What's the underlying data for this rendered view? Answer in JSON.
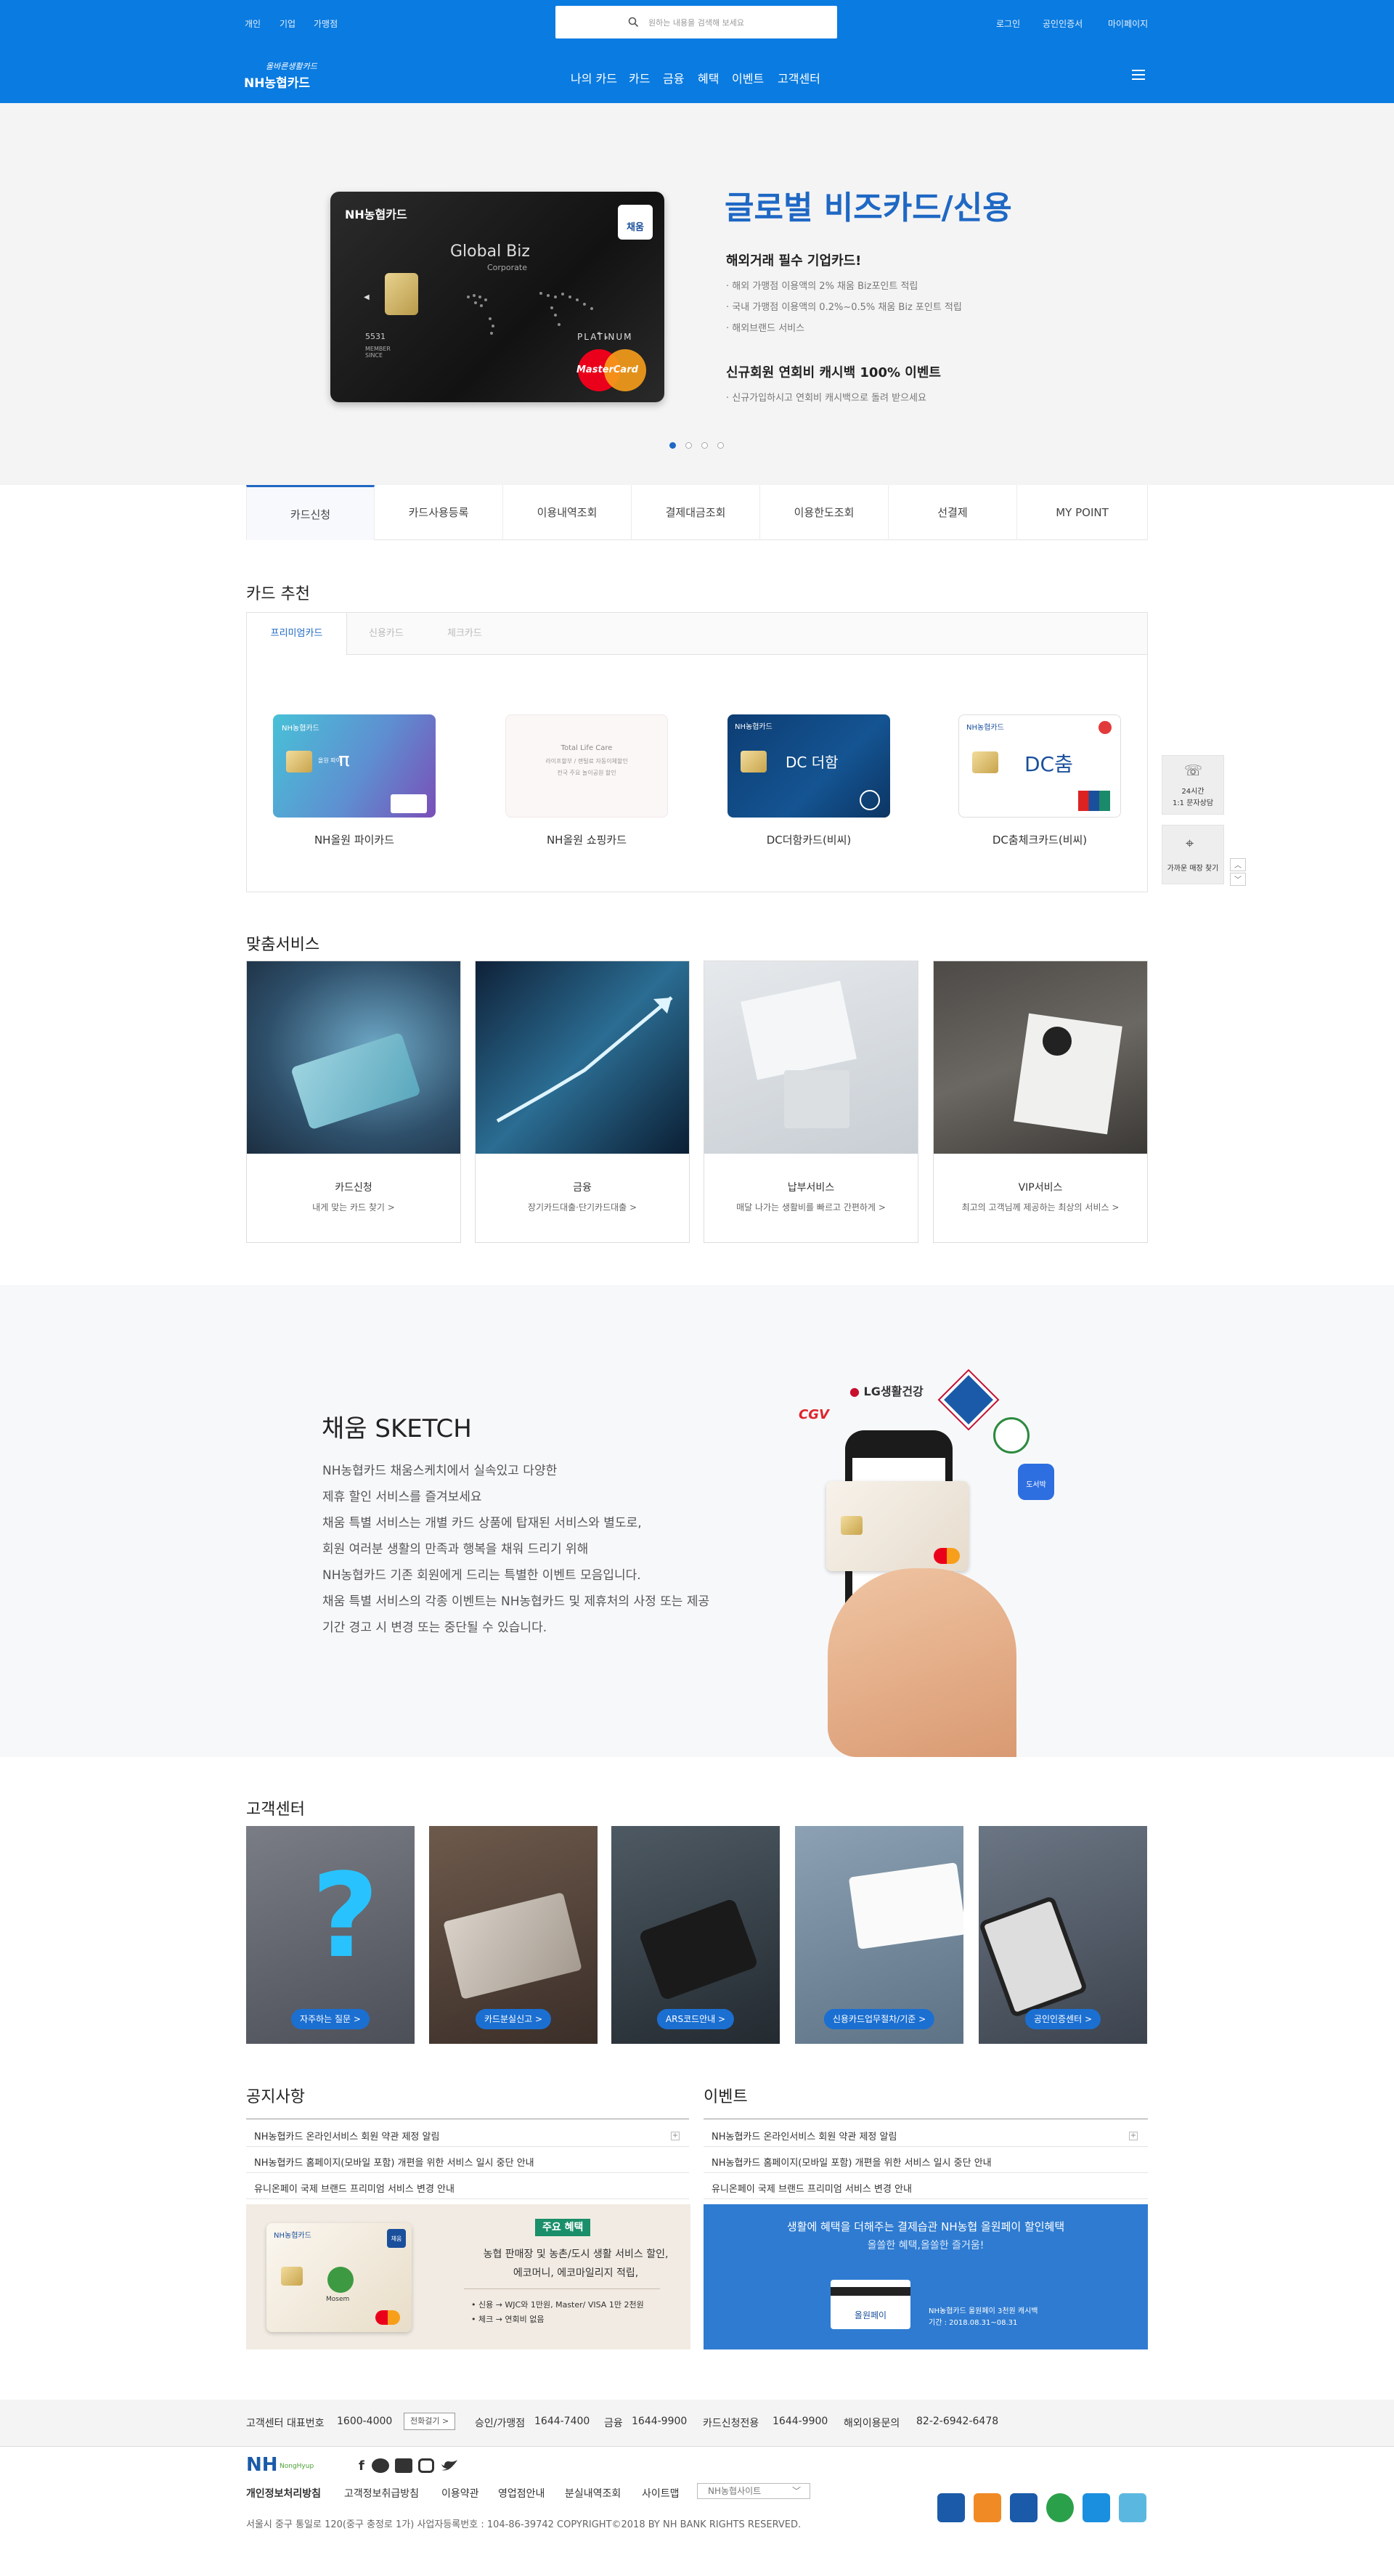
{
  "header": {
    "util_left": [
      "개인",
      "기업",
      "가맹점"
    ],
    "search_placeholder": "원하는 내용을 검색해 보세요",
    "util_right": [
      "로그인",
      "공인인증서",
      "마이페이지"
    ],
    "logo_top": "올바른생활카드",
    "logo_main": "NH농협카드",
    "nav": [
      "나의 카드",
      "카드",
      "금융",
      "혜택",
      "이벤트",
      "고객센터"
    ]
  },
  "hero": {
    "card_brand": "NH농협카드",
    "card_badge": "채움",
    "card_name": "Global Biz",
    "card_sub": "Corporate",
    "card_number": "5531",
    "card_member": "MEMBER SINCE",
    "card_tier": "PLATINUM",
    "card_network": "MasterCard",
    "title": "글로벌 비즈카드/신용",
    "subtitle": "해외거래 필수 기업카드!",
    "bullets": [
      "해외 가맹점 이용액의 2% 채움 Biz포인트 적립",
      "국내 가맹점 이용액의 0.2%~0.5% 채움 Biz 포인트 적립",
      "해외브랜드 서비스"
    ],
    "subtitle2": "신규회원 연회비 캐시백 100% 이벤트",
    "bullets2": [
      "신규가입하시고 연회비 캐시백으로 돌려 받으세요"
    ]
  },
  "tabs": [
    "카드신청",
    "카드사용등록",
    "이용내역조회",
    "결제대금조회",
    "이용한도조회",
    "선결제",
    "MY POINT"
  ],
  "recommend": {
    "title": "카드 추천",
    "tabs": [
      "프리미엄카드",
      "신용카드",
      "체크카드"
    ],
    "cards": [
      {
        "name": "NH올원 파이카드",
        "label": "NH농협카드",
        "mark": "π",
        "mark_sub": "올원 파이"
      },
      {
        "name": "NH올원 쇼핑카드",
        "label": "Total Life Care",
        "mark": "라이프할부 / 랜털료 자동이체할인",
        "mark_sub": "전국 주요 놀이공원 할인"
      },
      {
        "name": "DC더함카드(비씨)",
        "label": "NH농협카드",
        "mark": "DC 더함",
        "mark_sub": ""
      },
      {
        "name": "DC춤체크카드(비씨)",
        "label": "NH농협카드",
        "mark": "DC춤",
        "mark_sub": ""
      }
    ]
  },
  "side": {
    "item1_a": "24시간",
    "item1_b": "1:1 문자상담",
    "item2": "가까운 매장 찾기"
  },
  "custom": {
    "title": "맞춤서비스",
    "items": [
      {
        "t1": "카드신청",
        "t2": "내게 맞는 카드 찾기 >"
      },
      {
        "t1": "금융",
        "t2": "장기카드대출·단기카드대출 >"
      },
      {
        "t1": "납부서비스",
        "t2": "매달 나가는 생활비를 빠르고 간편하게 >"
      },
      {
        "t1": "VIP서비스",
        "t2": "최고의 고객님께 제공하는 최상의 서비스 >"
      }
    ]
  },
  "sketch": {
    "title": "채움 SKETCH",
    "lines": [
      "NH농협카드 채움스케치에서 실속있고 다양한",
      "제휴 할인 서비스를 즐겨보세요",
      "채움 특별 서비스는 개별 카드 상품에 탑재된 서비스와 별도로,",
      "회원 여러분 생활의 만족과 행복을 채워 드리기 위해",
      "NH농협카드 기존 회원에게 드리는 특별한 이벤트 모음입니다.",
      "채움 특별 서비스의 각종 이벤트는 NH농협카드 및 제휴처의 사정 또는 제공",
      "기간 경고 시 변경 또는 중단될 수 있습니다."
    ],
    "logos": [
      "CGV",
      "LG생활건강",
      "도서박"
    ]
  },
  "cs": {
    "title": "고객센터",
    "items": [
      "자주하는 질문 >",
      "카드분실신고 >",
      "ARS코드안내 >",
      "신용카드업무절차/기준 >",
      "공인인증센터 >"
    ]
  },
  "notice": {
    "title": "공지사항",
    "items": [
      "NH농협카드 온라인서비스 회원 약관 제정 알림",
      "NH농협카드 홈페이지(모바일 포함) 개편을 위한 서비스 일시 중단 안내",
      "유니온페이 국제 브랜드 프리미엄 서비스 변경 안내"
    ]
  },
  "event": {
    "title": "이벤트",
    "items": [
      "NH농협카드 온라인서비스 회원 약관 제정 알림",
      "NH농협카드 홈페이지(모바일 포함) 개편을 위한 서비스 일시 중단 안내",
      "유니온페이 국제 브랜드 프리미엄 서비스 변경 안내"
    ]
  },
  "promo1": {
    "badge": "주요 혜택",
    "l1": "농협 판매장 및 농촌/도시 생활 서비스 할인,",
    "l2": "에코머니, 에코마일리지 적립,",
    "l3": "• 신용 → WJC와 1만원, Master/ VISA 1만 2천원",
    "l4": "• 체크 → 연회비 없음",
    "card_brand": "NH농협카드",
    "card_badge": "채움",
    "card_name": "Mosem"
  },
  "promo2": {
    "l1": "생활에 혜택을 더해주는 결제습관 NH농협 올원페이 할인혜택",
    "l2": "올쏠한 혜택,올쏠한 즐거움!",
    "card_label": "올원페이",
    "s1": "NH농협카드 올원페이 3천원 캐시백",
    "s2": "기간 : 2018.08.31~08.31"
  },
  "footer": {
    "cs_label": "고객센터 대표번호",
    "cs_num": "1600-4000",
    "call_btn": "전화걸기 >",
    "nums": [
      {
        "l": "승인/가맹점",
        "n": "1644-7400"
      },
      {
        "l": "금융",
        "n": "1644-9900"
      },
      {
        "l": "카드신청전용",
        "n": "1644-9900"
      },
      {
        "l": "해외이용문의",
        "n": "82-2-6942-6478"
      }
    ],
    "logo": "NH",
    "logo_sub": "NongHyup",
    "links": [
      "개인정보처리방침",
      "고객정보취급방침",
      "이용약관",
      "영업점안내",
      "분실내역조회",
      "사이트맵"
    ],
    "site_select": "NH농협사이트",
    "address": "서울시 중구 통일로 120(중구 충정로 1가)  사업자등록번호 : 104-86-39742 COPYRIGHT©2018 BY NH BANK RIGHTS RESERVED."
  }
}
